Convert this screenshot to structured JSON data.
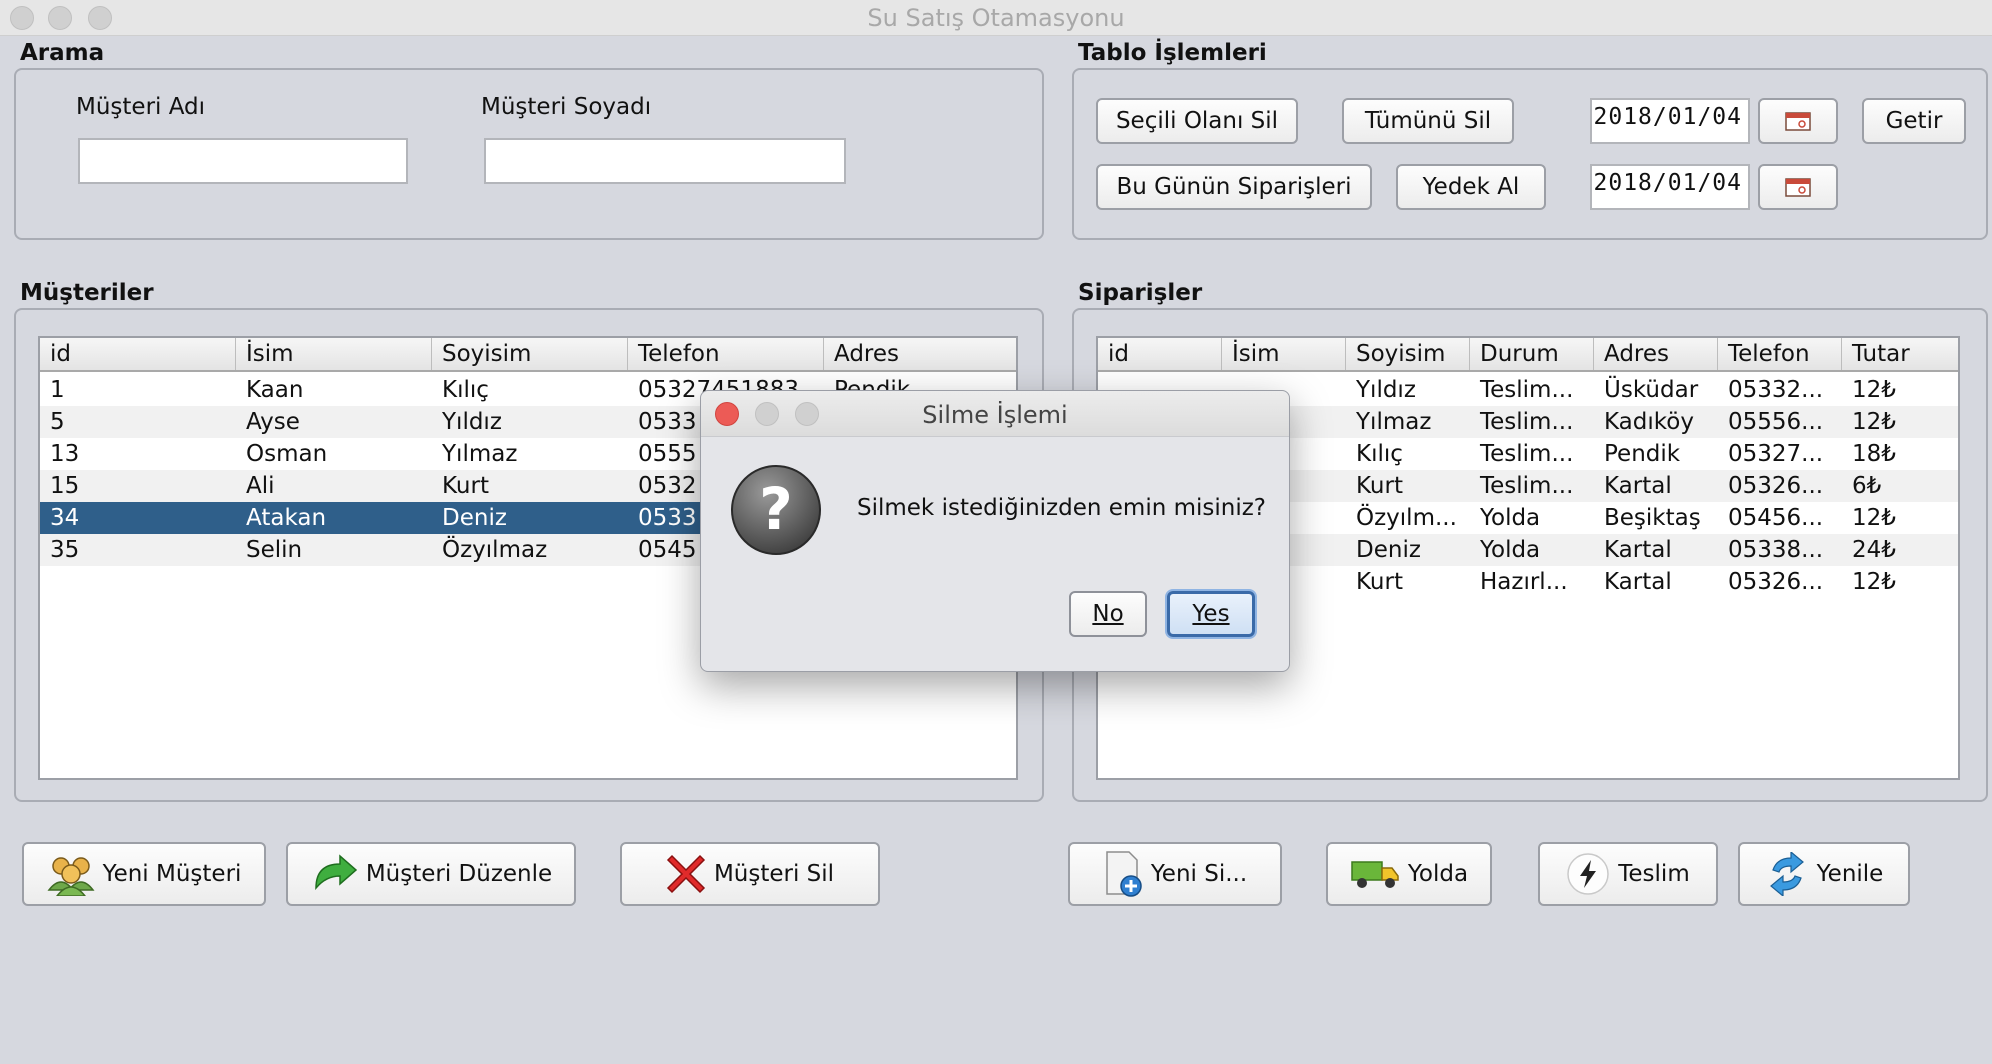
{
  "window": {
    "title": "Su Satış Otamasyonu"
  },
  "search": {
    "section_label": "Arama",
    "first_name_label": "Müşteri Adı",
    "last_name_label": "Müşteri Soyadı",
    "first_name_value": "",
    "last_name_value": ""
  },
  "table_ops": {
    "section_label": "Tablo İşlemleri",
    "delete_selected": "Seçili Olanı Sil",
    "delete_all": "Tümünü Sil",
    "todays_orders": "Bu Günün Siparişleri",
    "backup": "Yedek Al",
    "date_from": "2018/01/04",
    "date_to": "2018/01/04",
    "fetch": "Getir"
  },
  "customers": {
    "section_label": "Müşteriler",
    "columns": [
      "id",
      "İsim",
      "Soyisim",
      "Telefon",
      "Adres"
    ],
    "rows": [
      {
        "id": "1",
        "name": "Kaan",
        "surname": "Kılıç",
        "phone": "05327451883",
        "address": "Pendik"
      },
      {
        "id": "5",
        "name": "Ayse",
        "surname": "Yıldız",
        "phone": "0533",
        "address": ""
      },
      {
        "id": "13",
        "name": "Osman",
        "surname": "Yılmaz",
        "phone": "0555",
        "address": ""
      },
      {
        "id": "15",
        "name": "Ali",
        "surname": "Kurt",
        "phone": "0532",
        "address": ""
      },
      {
        "id": "34",
        "name": "Atakan",
        "surname": "Deniz",
        "phone": "0533",
        "address": ""
      },
      {
        "id": "35",
        "name": "Selin",
        "surname": "Özyılmaz",
        "phone": "0545",
        "address": ""
      }
    ],
    "selected_index": 4
  },
  "orders": {
    "section_label": "Siparişler",
    "columns": [
      "id",
      "İsim",
      "Soyisim",
      "Durum",
      "Adres",
      "Telefon",
      "Tutar"
    ],
    "rows": [
      {
        "id": "",
        "name": "",
        "surname": "Yıldız",
        "status": "Teslim...",
        "address": "Üsküdar",
        "phone": "05332...",
        "amount": "12₺"
      },
      {
        "id": "",
        "name": "an",
        "surname": "Yılmaz",
        "status": "Teslim...",
        "address": "Kadıköy",
        "phone": "05556...",
        "amount": "12₺"
      },
      {
        "id": "",
        "name": "",
        "surname": "Kılıç",
        "status": "Teslim...",
        "address": "Pendik",
        "phone": "05327...",
        "amount": "18₺"
      },
      {
        "id": "",
        "name": "",
        "surname": "Kurt",
        "status": "Teslim...",
        "address": "Kartal",
        "phone": "05326...",
        "amount": "6₺"
      },
      {
        "id": "",
        "name": "",
        "surname": "Özyılm...",
        "status": "Yolda",
        "address": "Beşiktaş",
        "phone": "05456...",
        "amount": "12₺"
      },
      {
        "id": "",
        "name": "an",
        "surname": "Deniz",
        "status": "Yolda",
        "address": "Kartal",
        "phone": "05338...",
        "amount": "24₺"
      },
      {
        "id": "",
        "name": "",
        "surname": "Kurt",
        "status": "Hazırl...",
        "address": "Kartal",
        "phone": "05326...",
        "amount": "12₺"
      }
    ]
  },
  "actions": {
    "new_customer": "Yeni Müşteri",
    "edit_customer": "Müşteri Düzenle",
    "delete_customer": "Müşteri Sil",
    "new_order": "Yeni Si...",
    "on_the_way": "Yolda",
    "delivered": "Teslim",
    "refresh": "Yenile"
  },
  "dialog": {
    "title": "Silme İşlemi",
    "message": "Silmek istediğinizden emin misiniz?",
    "no": "No",
    "yes": "Yes"
  },
  "colors": {
    "selection": "#2f5f8a",
    "background": "#d6d8df",
    "close_red": "#ec5b56"
  }
}
